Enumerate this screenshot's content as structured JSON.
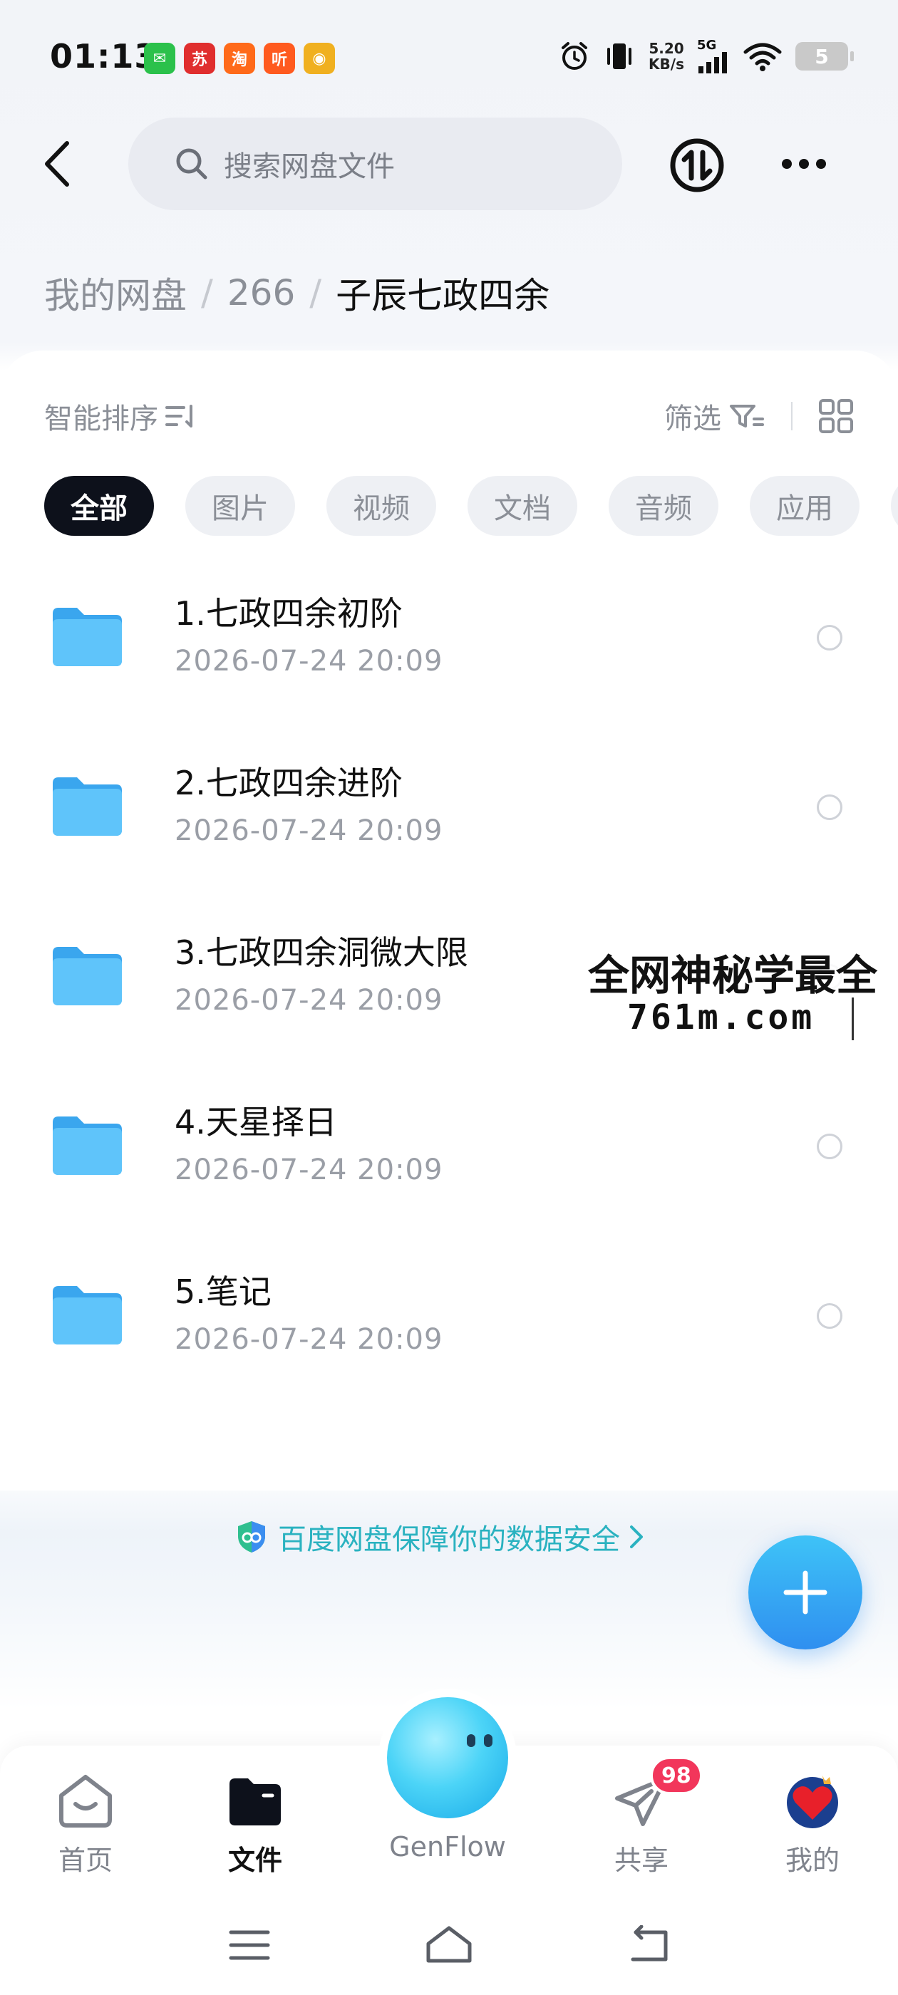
{
  "status_bar": {
    "time": "01:13",
    "apps": [
      {
        "icon": "wechat-icon",
        "glyph": "✉",
        "color": "#2bc14b"
      },
      {
        "icon": "xiaohongshu-icon",
        "glyph": "苏",
        "color": "#e02e2e"
      },
      {
        "icon": "taobao-icon",
        "glyph": "淘",
        "color": "#ff6a1a"
      },
      {
        "icon": "ting-icon",
        "glyph": "听",
        "color": "#ff5a1f"
      },
      {
        "icon": "weibo-icon",
        "glyph": "◉",
        "color": "#f0b020"
      }
    ],
    "net_speed_value": "5.20",
    "net_speed_unit": "KB/s",
    "network": "5G",
    "battery": "5"
  },
  "header": {
    "search_placeholder": "搜索网盘文件"
  },
  "breadcrumb": {
    "items": [
      "我的网盘",
      "266"
    ],
    "current": "子辰七政四余"
  },
  "toolbar": {
    "sort_label": "智能排序",
    "filter_label": "筛选"
  },
  "tabs": [
    {
      "label": "全部",
      "active": true
    },
    {
      "label": "图片",
      "active": false
    },
    {
      "label": "视频",
      "active": false
    },
    {
      "label": "文档",
      "active": false
    },
    {
      "label": "音频",
      "active": false
    },
    {
      "label": "应用",
      "active": false
    }
  ],
  "files": [
    {
      "name": "1.七政四余初阶",
      "date": "2026-07-24  20:09"
    },
    {
      "name": "2.七政四余进阶",
      "date": "2026-07-24  20:09"
    },
    {
      "name": "3.七政四余洞微大限",
      "date": "2026-07-24  20:09"
    },
    {
      "name": "4.天星择日",
      "date": "2026-07-24  20:09"
    },
    {
      "name": "5.笔记",
      "date": "2026-07-24  20:09"
    }
  ],
  "watermark": {
    "line1": "全网神秘学最全",
    "line2": "761m.com"
  },
  "security_note": "百度网盘保障你的数据安全",
  "bottom_nav": {
    "items": [
      {
        "label": "首页",
        "icon": "home-icon"
      },
      {
        "label": "文件",
        "icon": "folder-icon",
        "active": true
      },
      {
        "label": "GenFlow",
        "icon": "genflow-icon"
      },
      {
        "label": "共享",
        "icon": "share-icon"
      },
      {
        "label": "我的",
        "icon": "avatar-icon"
      }
    ],
    "share_badge": "98"
  },
  "colors": {
    "accent": "#2f8ff0",
    "security_text": "#2ab2c0",
    "badge": "#f2365b",
    "folder": "#4cb8f5"
  }
}
